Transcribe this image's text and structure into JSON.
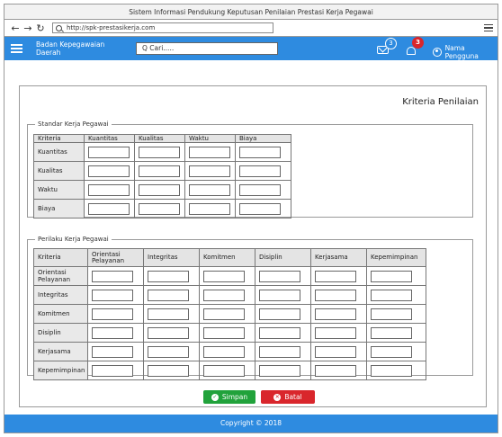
{
  "window": {
    "title": "Sistem Informasi Pendukung Keputusan Penilaian Prestasi Kerja Pegawai"
  },
  "browser": {
    "url": "http://spk-prestasikerja.com"
  },
  "appbar": {
    "brand": "Badan Kepegawaian Daerah",
    "search_placeholder": "Q Cari.....",
    "messages_count": "3",
    "notifications_count": "3",
    "user_name": "Nama Pengguna"
  },
  "page": {
    "title": "Kriteria Penilaian"
  },
  "standar": {
    "legend": "Standar Kerja Pegawai",
    "headers": [
      "Kriteria",
      "Kuantitas",
      "Kualitas",
      "Waktu",
      "Biaya"
    ],
    "rows": [
      "Kuantitas",
      "Kualitas",
      "Waktu",
      "Biaya"
    ]
  },
  "perilaku": {
    "legend": "Perilaku Kerja Pegawai",
    "headers": [
      "Kriteria",
      "Orientasi Pelayanan",
      "Integritas",
      "Komitmen",
      "Disiplin",
      "Kerjasama",
      "Kepemimpinan"
    ],
    "rows": [
      "Orientasi Pelayanan",
      "Integritas",
      "Komitmen",
      "Disiplin",
      "Kerjasama",
      "Kepemimpinan"
    ]
  },
  "actions": {
    "save": "Simpan",
    "cancel": "Batal"
  },
  "footer": {
    "text": "Copyright © 2018"
  },
  "colors": {
    "primary": "#2e8be0",
    "save": "#21a23b",
    "cancel": "#d9262c"
  }
}
